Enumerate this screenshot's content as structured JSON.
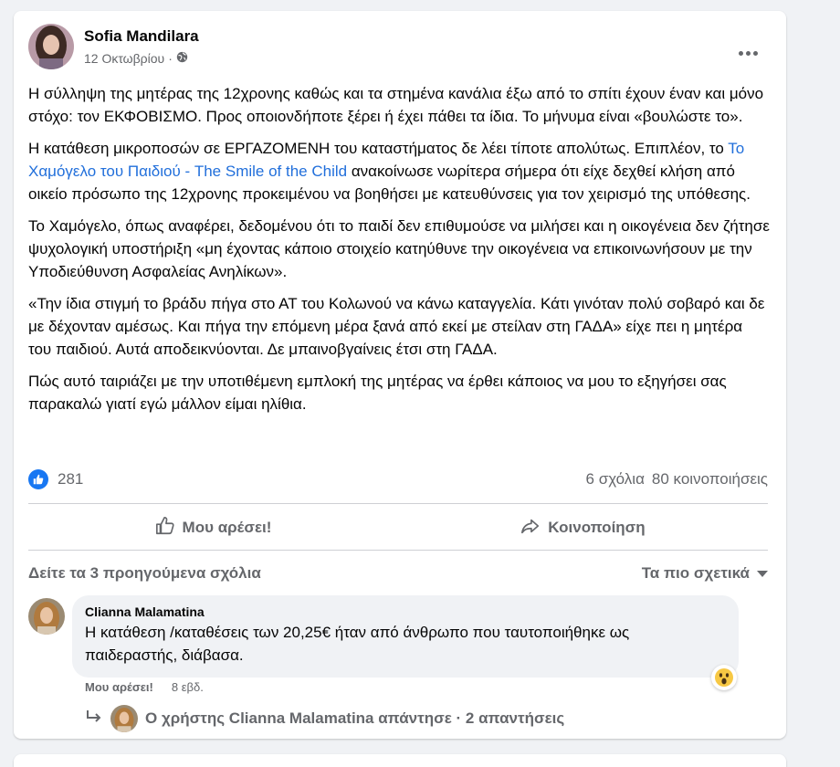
{
  "post": {
    "author": "Sofia Mandilara",
    "date": "12 Οκτωβρίου",
    "date_separator": "·",
    "paragraphs": [
      "Η σύλληψη της μητέρας της 12χρονης καθώς και τα στημένα κανάλια έξω από το σπίτι έχουν έναν και μόνο στόχο: τον ΕΚΦΟΒΙΣΜΟ. Προς οποιονδήποτε ξέρει ή έχει πάθει τα ίδια. Το μήνυμα είναι «βουλώστε το».",
      "Το Χαμόγελο, όπως αναφέρει, δεδομένου ότι το παιδί δεν επιθυμούσε να μιλήσει και η οικογένεια δεν ζήτησε ψυχολογική υποστήριξη «μη έχοντας κάποιο στοιχείο κατηύθυνε την οικογένεια να επικοινωνήσουν με την Υποδιεύθυνση Ασφαλείας Ανηλίκων».",
      "«Την ίδια στιγμή το βράδυ πήγα στο ΑΤ του Κολωνού να κάνω καταγγελία. Κάτι γινόταν πολύ σοβαρό και δε με δέχονταν αμέσως. Και πήγα την επόμενη μέρα ξανά από εκεί με στείλαν στη ΓΑΔΑ» είχε πει η μητέρα του παιδιού. Αυτά αποδεικνύονται. Δε μπαινοβγαίνεις έτσι στη ΓΑΔΑ.",
      "Πώς αυτό ταιριάζει με την υποτιθέμενη εμπλοκή της μητέρας να έρθει κάποιος να μου το εξηγήσει σας παρακαλώ γιατί εγώ μάλλον είμαι ηλίθια."
    ],
    "paragraph2": {
      "before": "Η κατάθεση μικροποσών σε ΕΡΓΑΖΟΜΕΝΗ του καταστήματος δε λέει τίποτε απολύτως. Επιπλέον, το ",
      "link": "Το Χαμόγελο του Παιδιού - The Smile of the Child",
      "after": " ανακοίνωσε νωρίτερα σήμερα ότι είχε δεχθεί κλήση από οικείο πρόσωπο της 12χρονης προκειμένου να βοηθήσει με κατευθύνσεις για τον χειρισμό της υπόθεσης."
    },
    "likes": "281",
    "comments_count": "6 σχόλια",
    "shares_count": "80 κοινοποιήσεις",
    "like_label": "Μου αρέσει!",
    "share_label": "Κοινοποίηση"
  },
  "comments": {
    "view_previous": "Δείτε τα 3 προηγούμενα σχόλια",
    "sort_label": "Τα πιο σχετικά",
    "items": [
      {
        "author": "Clianna Malamatina",
        "text": "Η κατάθεση /καταθέσεις των 20,25€ ήταν από άνθρωπο που ταυτοποιήθηκε ως παιδεραστής, διάβασα.",
        "like_label": "Μου αρέσει!",
        "time": "8 εβδ.",
        "reaction": "wow",
        "replies_text": "Ο χρήστης Clianna Malamatina απάντησε · 2 απαντήσεις"
      }
    ]
  },
  "colors": {
    "link": "#216fdb",
    "like_blue": "#1877f2",
    "secondary_text": "#65676b",
    "background": "#f0f2f5"
  }
}
